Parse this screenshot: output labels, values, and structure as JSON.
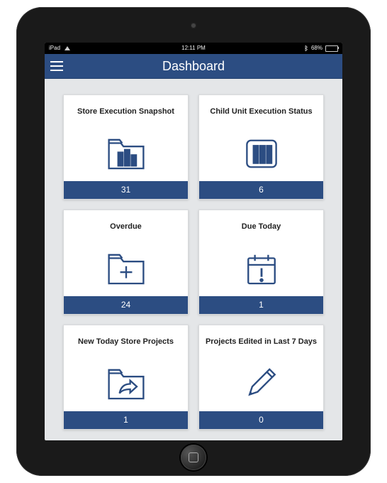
{
  "status_bar": {
    "carrier": "iPad",
    "time": "12:11 PM",
    "battery_percent": "68%"
  },
  "navbar": {
    "title": "Dashboard"
  },
  "tiles": [
    {
      "title": "Store Execution Snapshot",
      "count": "31",
      "icon": "folder-bars-icon"
    },
    {
      "title": "Child Unit Execution Status",
      "count": "6",
      "icon": "bars-icon"
    },
    {
      "title": "Overdue",
      "count": "24",
      "icon": "folder-plus-icon"
    },
    {
      "title": "Due Today",
      "count": "1",
      "icon": "calendar-alert-icon"
    },
    {
      "title": "New Today Store Projects",
      "count": "1",
      "icon": "folder-arrow-icon"
    },
    {
      "title": "Projects Edited in Last 7 Days",
      "count": "0",
      "icon": "pencil-icon"
    }
  ],
  "colors": {
    "accent": "#2c4d82"
  }
}
